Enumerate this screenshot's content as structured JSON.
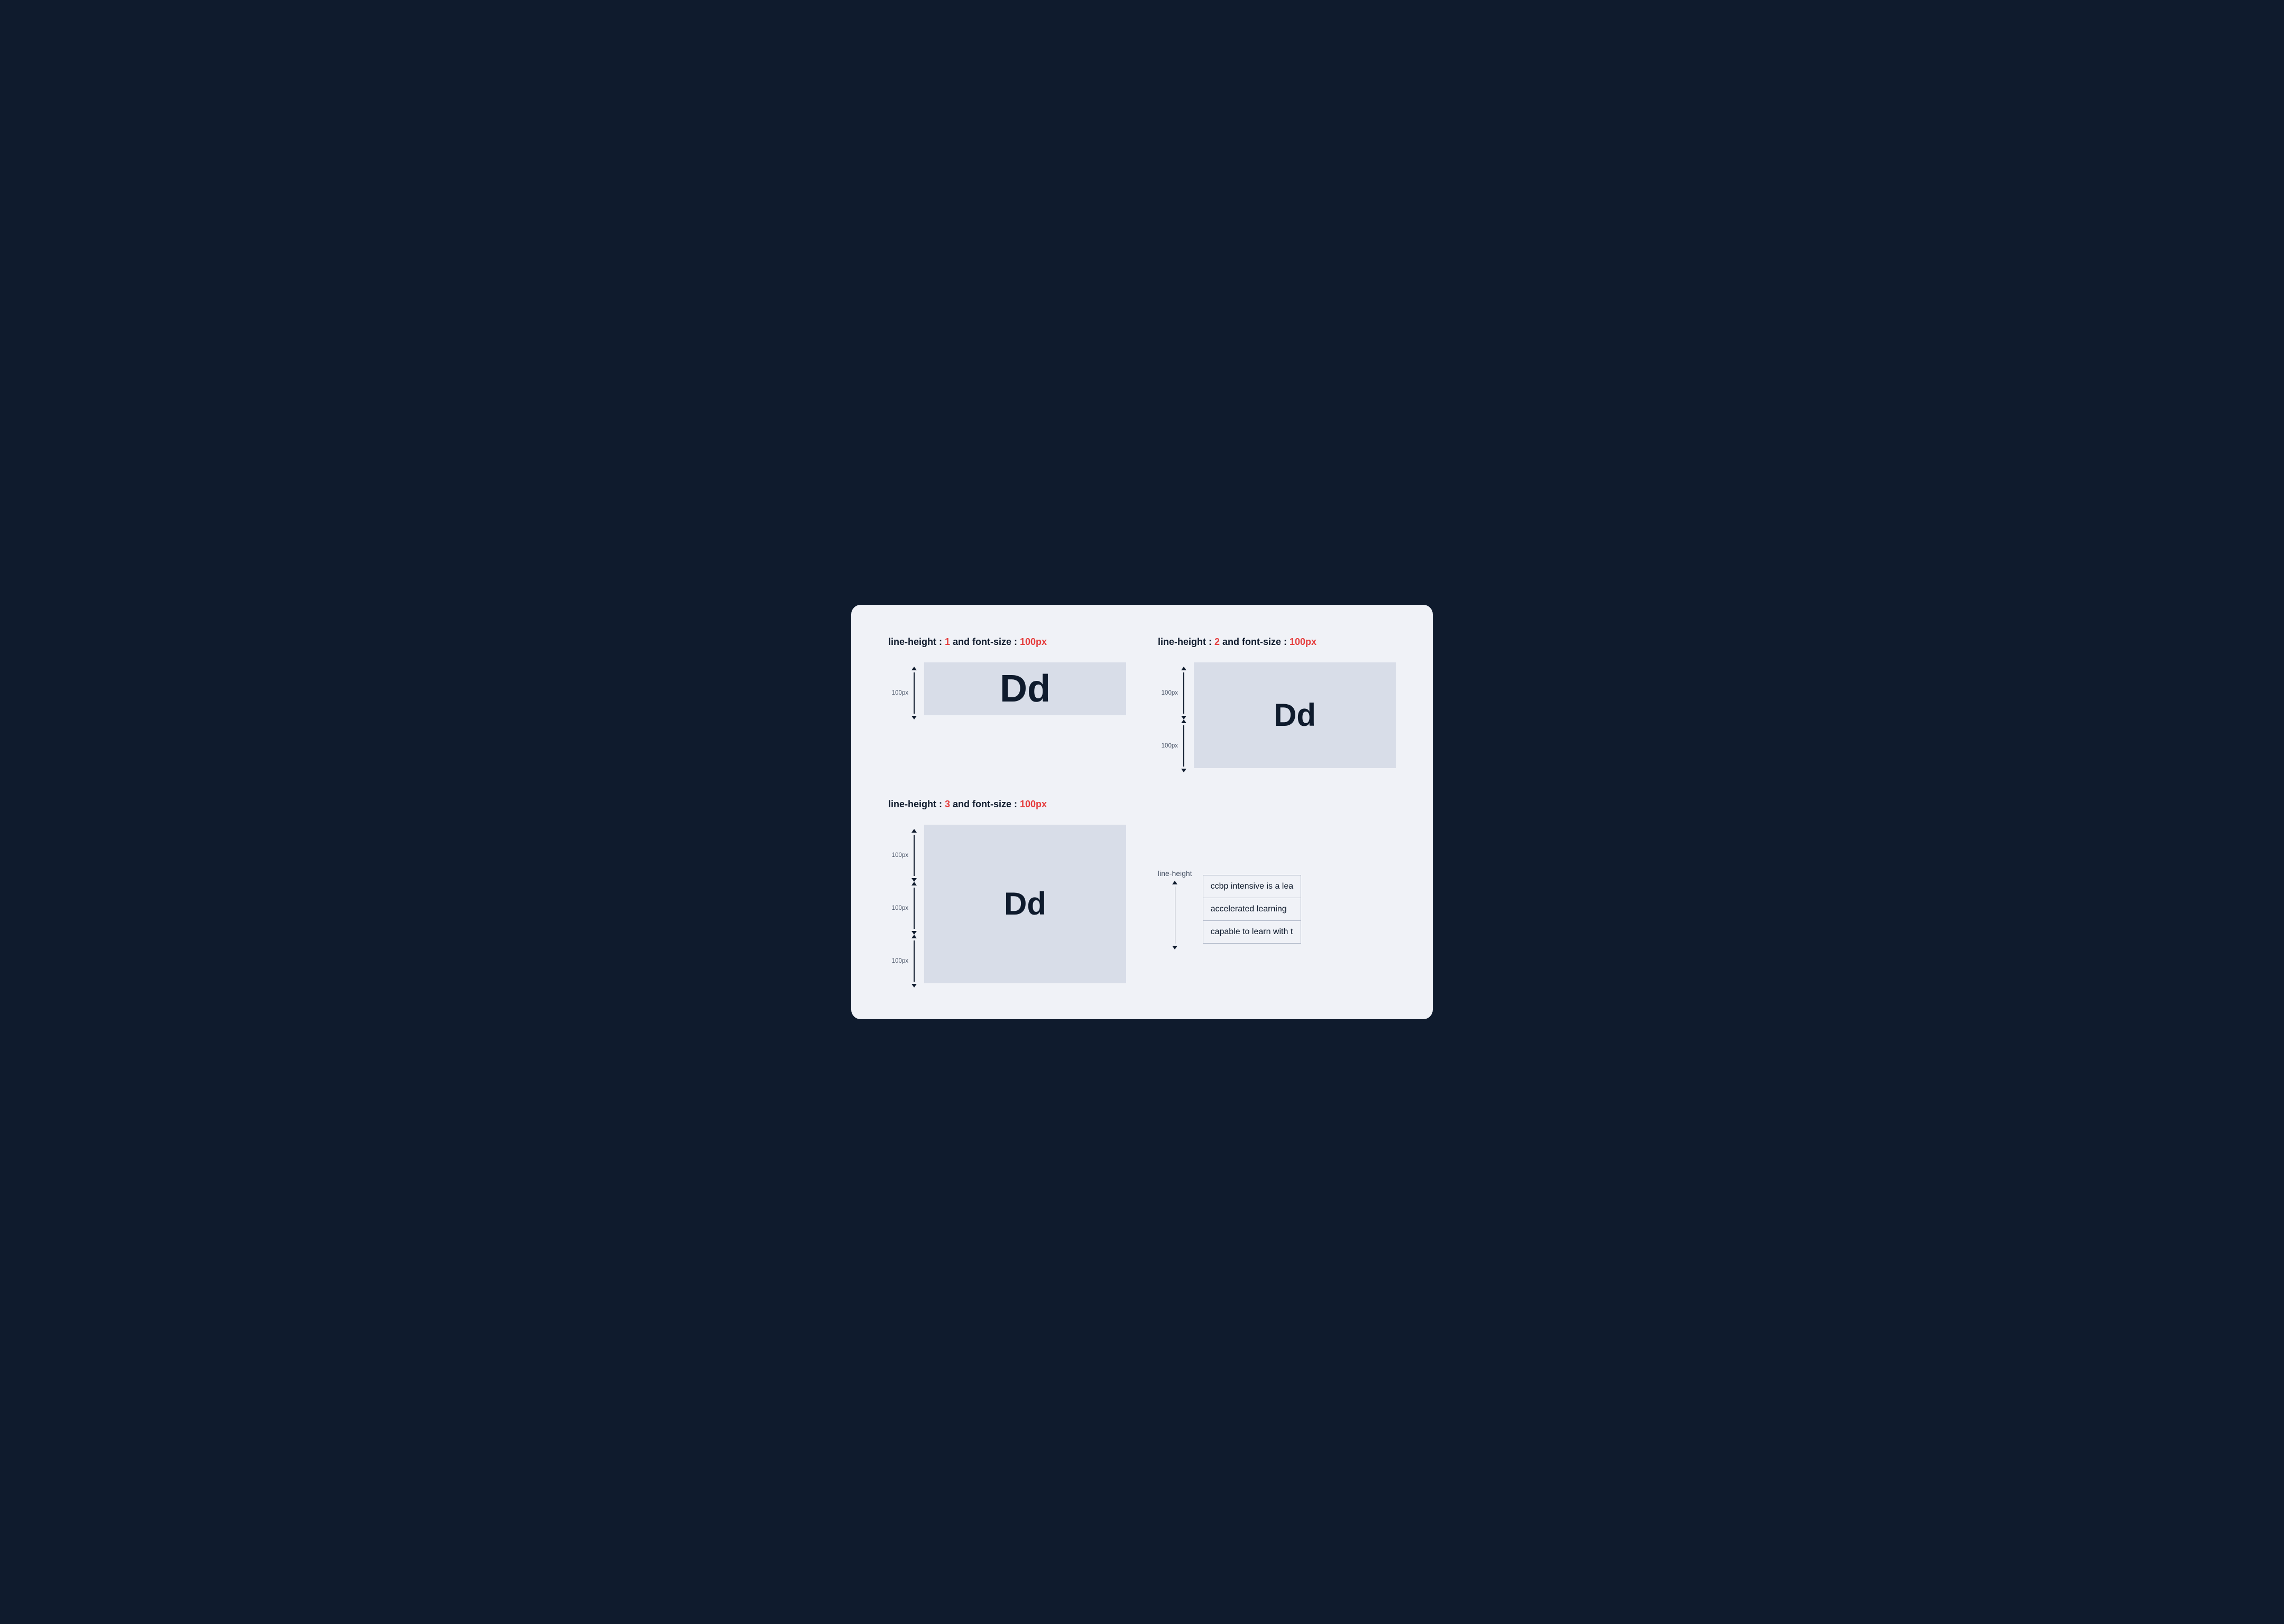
{
  "card": {
    "section1": {
      "title_prefix": "line-height : ",
      "title_lh": "1",
      "title_mid": " and font-size : ",
      "title_fs": "100px",
      "px_label": "100px",
      "dd_text": "Dd"
    },
    "section2": {
      "title_prefix": "line-height : ",
      "title_lh": "2",
      "title_mid": " and font-size : ",
      "title_fs": "100px",
      "px_label_top": "100px",
      "px_label_bottom": "100px",
      "dd_text": "Dd"
    },
    "section3": {
      "title_prefix": "line-height : ",
      "title_lh": "3",
      "title_mid": " and font-size : ",
      "title_fs": "100px",
      "px_label_top": "100px",
      "px_label_mid": "100px",
      "px_label_bottom": "100px",
      "dd_text": "Dd"
    },
    "section4": {
      "lh_label": "line-height",
      "line1": "ccbp intensive is a lea",
      "line2": "accelerated learning",
      "line3": "capable to learn with t"
    }
  },
  "colors": {
    "accent_red": "#e53e3e",
    "dark_navy": "#0f1b2d",
    "medium_gray": "#4a5568",
    "box_bg": "#d8dde8",
    "card_bg": "#f0f2f7"
  }
}
